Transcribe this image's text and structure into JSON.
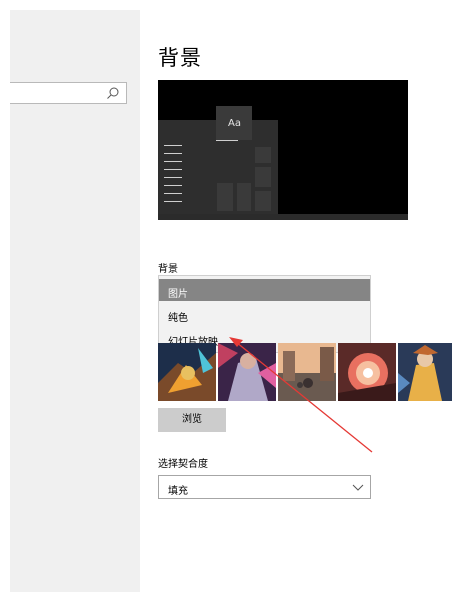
{
  "window": {
    "title": "背景"
  },
  "search": {
    "placeholder": ""
  },
  "preview": {
    "tile_text": "Aa"
  },
  "background_section": {
    "label": "背景",
    "dropdown_options": [
      "图片",
      "纯色",
      "幻灯片放映"
    ],
    "selected_option": "图片"
  },
  "pictures": {
    "thumbnails": [
      "dragon-artwork",
      "armored-warrior-artwork",
      "street-scene-artwork",
      "glowing-orb-artwork",
      "heroine-artwork"
    ],
    "browse_label": "浏览"
  },
  "fit": {
    "label": "选择契合度",
    "value": "填充"
  },
  "colors": {
    "selected_option_bg": "#858585",
    "annotation_arrow": "#e53935",
    "sidebar_bg": "#f0f0f0"
  }
}
